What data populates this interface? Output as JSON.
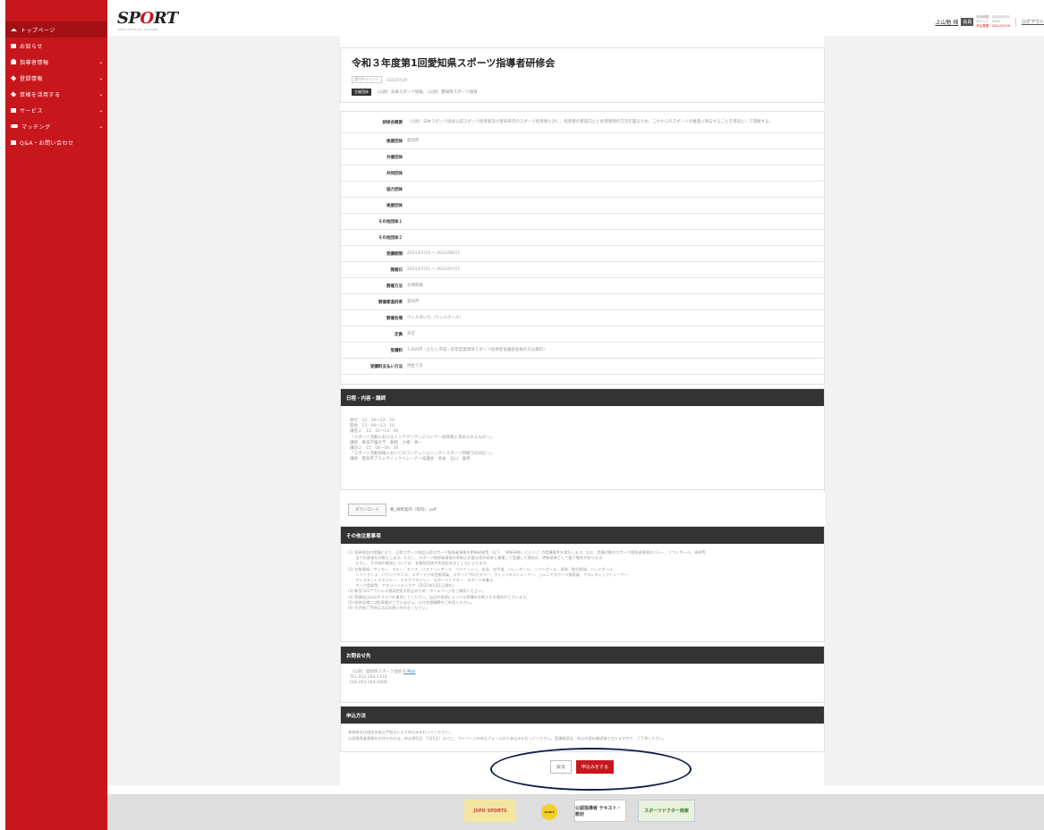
{
  "sidebar": {
    "items": [
      {
        "label": "トップページ",
        "icon": "home-icon",
        "has_chevron": false,
        "active": true
      },
      {
        "label": "お知らせ",
        "icon": "speech-icon",
        "has_chevron": false
      },
      {
        "label": "指導者情報",
        "icon": "person-icon",
        "has_chevron": true
      },
      {
        "label": "登録情報",
        "icon": "tag-icon",
        "has_chevron": true
      },
      {
        "label": "資格を活用する",
        "icon": "tag-icon",
        "has_chevron": true
      },
      {
        "label": "サービス",
        "icon": "grid-icon",
        "has_chevron": true
      },
      {
        "label": "マッチング",
        "icon": "handshake-icon",
        "has_chevron": true
      },
      {
        "label": "Q&A・お問い合わせ",
        "icon": "mail-icon",
        "has_chevron": false
      }
    ],
    "chevron": "⌄",
    "color": "#c8161d"
  },
  "header": {
    "logo_left": "SP",
    "logo_o": "O",
    "logo_right": "RT",
    "logo_sub": "JSPO OFFICIAL SYSTEM",
    "user_name": "上山勉 様",
    "badge": "会員",
    "stat1": "有効期限：2024/03/31",
    "stat2": "ポイント：1000",
    "stat3": "申込履歴：2021/07/29",
    "logout": "ログアウト"
  },
  "event": {
    "title": "令和３年度第1回愛知県スポーツ指導者研修会",
    "meta_tag": "受付中イベント",
    "meta_date": "2021/07/29",
    "org_tag": "主催団体",
    "org_text": "（公財）日本スポーツ協会、（公財）愛知県スポーツ協会"
  },
  "info": {
    "rows": [
      {
        "key": "研修会概要",
        "value": "（公財）日本スポーツ協会公認スポーツ指導者及び愛知県内のスポーツ指導者に対し、指導者の資質向上と指導者間の交流を図るため、これからのスポーツの推進に寄与することを目的として開催する。",
        "tall": true
      },
      {
        "key": "後援団体",
        "value": "愛知県"
      },
      {
        "key": "共催団体",
        "value": ""
      },
      {
        "key": "共同団体",
        "value": ""
      },
      {
        "key": "協力団体",
        "value": ""
      },
      {
        "key": "後援団体",
        "value": ""
      },
      {
        "key": "その他団体１",
        "value": ""
      },
      {
        "key": "その他団体２",
        "value": ""
      },
      {
        "key": "受講期間",
        "value": "2021/07/10 ～ 2021/08/11"
      },
      {
        "key": "開催日",
        "value": "2021/07/11 ～ 2021/07/11"
      },
      {
        "key": "開催方法",
        "value": "会場開催"
      },
      {
        "key": "開催都道府県",
        "value": "愛知県"
      },
      {
        "key": "開催会場",
        "value": "ウィルあいち（ウィルホール）"
      },
      {
        "key": "定員",
        "value": "未定"
      },
      {
        "key": "受講料",
        "value": "1,000円（ただし平成・前年度愛知県スポーツ指導者協議会会員の方は無料）"
      },
      {
        "key": "受講料支払い方法",
        "value": "現金で支"
      }
    ]
  },
  "schedule": {
    "heading": "日程・内容・講師",
    "lines": [
      "受付　12：30～12：50",
      "開会　13：00～13：10",
      "講話１　13：10～14：40",
      "「スポーツ活動におけるインテグリティについて～指導者に求められるもの～」",
      "講師　東海学園大学　教授　大橋　秀一",
      "講話２　15：00～16：30",
      "「スポーツ活動現場においてのコンディショニング～スポーツ現場での対応～」",
      "講師　愛知県アスレティックトレーナー協議会　会長　石川　義男"
    ]
  },
  "download": {
    "button": "ダウンロード",
    "file": "要_研修案内（有料）.pdf"
  },
  "notes": {
    "heading": "その他注意事項",
    "lines": [
      "(1) 本研修会の受講により、日本スポーツ協会公認スポーツ指導者資格の更新研修等（以下、「更新研修」という。）の受講要件を満たします。なお、受講対象のスポーツ指導者資格はバレー、ソフトボール、卓球等",
      "　　全ての資格を対象とします。ただし、スポーツ指導者資格の更新に必要な他の研修と重複して受講した場合は、更新研修として扱う場合があります。",
      "　　ただし、その他の競技については、各競技団体が別途定めるところによります。",
      "(2) 対象資格：サッカー、スキー、テニス、バスケットボール、バドミントン、水泳、空手道、バレーボール、ソフトボール、卓球、軟式野球、ハンドボール、",
      "　　ソフトテニス、バウンドテニス、スポーツ少年団指導員、スポーツプログラマー、フィットネストレーナー、ジュニアスポーツ指導員、アスレティックトレーナー、",
      "　　アシスタントマネジャー、クラブマネジャー、スポーツドクター、スポーツ栄養士、",
      "　　ワーク登録等、アスリートキャリア（2021年5月1日現在）",
      "(3) 新型コロナウイルス感染症拡大防止のため、ホームページをご確認ください。",
      "(4) 受講当日は必ずマスクを着用してください。当日の体調によっては受講をお断りする場合がございます。",
      "(5) 研修会場には駐車場がございません。公共交通機関をご利用ください。",
      "(6) その他ご不明な点はお問い合わせください。"
    ]
  },
  "contact": {
    "heading": "お問合せ先",
    "org": "（公財）愛知県スポーツ協会",
    "link": "E-Mail",
    "tel": "TEL:052-264-1310",
    "fax": "FAX:052-264-0909"
  },
  "method": {
    "heading": "申込方法",
    "lines": [
      "本研修会は指定の申込手続きにより申込みを行ってください。",
      "公認指導者資格をお持ちの方は、申込締切日（7月5日）までに、マイページの申込フォームから申込みを行ってください。受講確認は、申込内容の確認後となりますので、ご了承ください。"
    ]
  },
  "buttons": {
    "back": "戻る",
    "apply": "申込みをする"
  },
  "footer": {
    "banner1": "JSPO SPORTS",
    "banner2": "SPORTS",
    "banner3": "公認指導者 テキスト・教材",
    "banner4": "スポーツドクター検索"
  }
}
